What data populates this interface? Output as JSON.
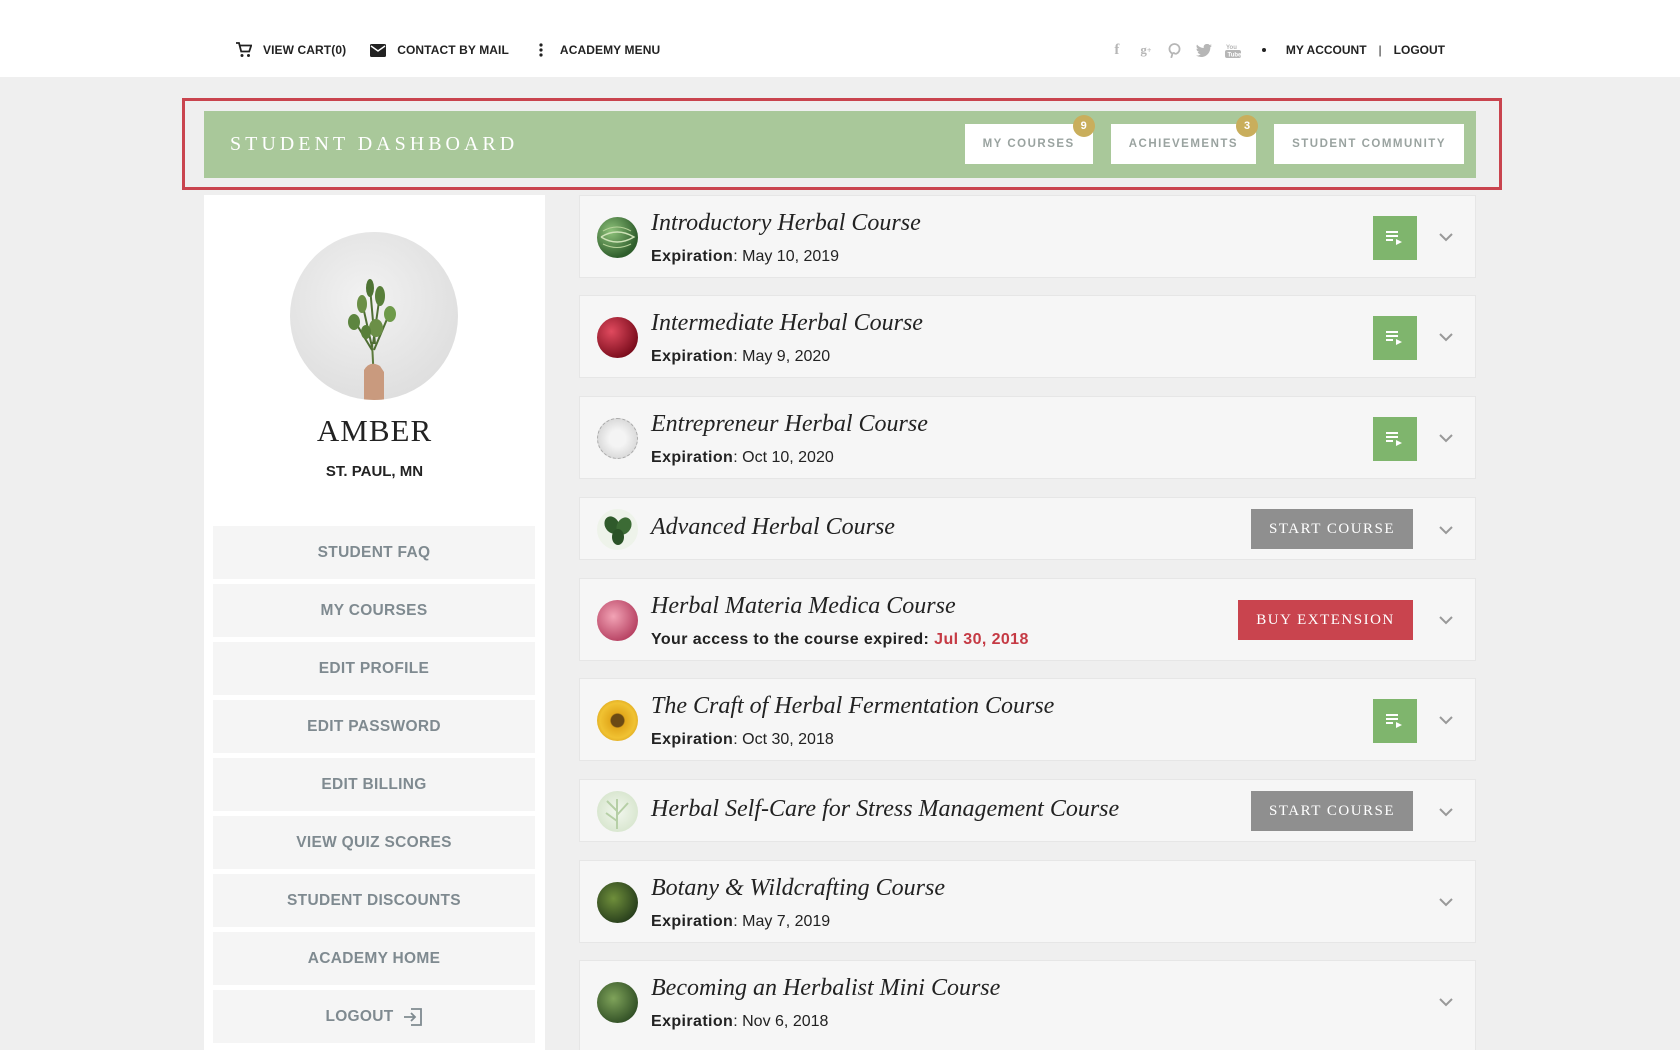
{
  "topbar": {
    "cart": "VIEW CART(0)",
    "contact": "CONTACT BY MAIL",
    "academy_menu": "ACADEMY MENU",
    "social_icons": [
      "facebook-icon",
      "google-plus-icon",
      "pinterest-icon",
      "twitter-icon",
      "youtube-icon"
    ],
    "my_account": "MY ACCOUNT",
    "separator": "|",
    "logout": "LOGOUT"
  },
  "dashboard": {
    "title": "STUDENT DASHBOARD",
    "tabs": [
      {
        "label": "MY COURSES",
        "badge": "9"
      },
      {
        "label": "ACHIEVEMENTS",
        "badge": "3"
      },
      {
        "label": "STUDENT COMMUNITY",
        "badge": ""
      }
    ]
  },
  "profile": {
    "name": "AMBER",
    "location": "ST. PAUL, MN"
  },
  "sidebar_menu": [
    "STUDENT FAQ",
    "MY COURSES",
    "EDIT PROFILE",
    "EDIT PASSWORD",
    "EDIT BILLING",
    "VIEW QUIZ SCORES",
    "STUDENT DISCOUNTS",
    "ACADEMY HOME",
    "LOGOUT"
  ],
  "courses": [
    {
      "title": "Introductory Herbal Course",
      "exp_label": "Expiration",
      "exp_value": ": May 10, 2019",
      "action": "play"
    },
    {
      "title": "Intermediate Herbal Course",
      "exp_label": "Expiration",
      "exp_value": ": May 9, 2020",
      "action": "play"
    },
    {
      "title": "Entrepreneur Herbal Course",
      "exp_label": "Expiration",
      "exp_value": ": Oct 10, 2020",
      "action": "play"
    },
    {
      "title": "Advanced Herbal Course",
      "exp_label": "",
      "exp_value": "",
      "action": "START COURSE"
    },
    {
      "title": "Herbal Materia Medica Course",
      "exp_label": "Your access to the course expired: ",
      "exp_value": "Jul 30, 2018",
      "action": "BUY EXTENSION"
    },
    {
      "title": "The Craft of Herbal Fermentation Course",
      "exp_label": "Expiration",
      "exp_value": ": Oct 30, 2018",
      "action": "play"
    },
    {
      "title": "Herbal Self-Care for Stress Management Course",
      "exp_label": "",
      "exp_value": "",
      "action": "START COURSE"
    },
    {
      "title": "Botany & Wildcrafting Course",
      "exp_label": "Expiration",
      "exp_value": ": May 7, 2019",
      "action": ""
    },
    {
      "title": "Becoming an Herbalist Mini Course",
      "exp_label": "Expiration",
      "exp_value": ": Nov 6, 2018",
      "action": ""
    }
  ],
  "colors": {
    "header_green": "#a9c89a",
    "play_green": "#7fb56d",
    "frame_red": "#c9444e",
    "badge_gold": "#c9ae5c",
    "start_gray": "#8f8f8f"
  }
}
